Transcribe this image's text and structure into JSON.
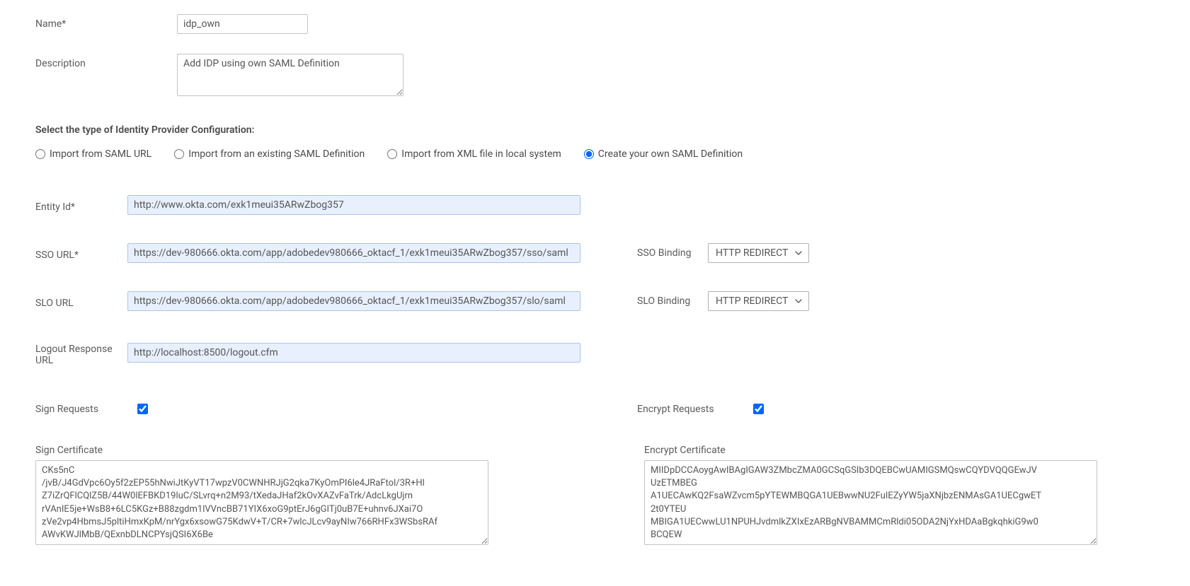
{
  "name": {
    "label": "Name*",
    "value": "idp_own"
  },
  "description": {
    "label": "Description",
    "value": "Add IDP using own SAML Definition"
  },
  "config_type": {
    "label": "Select the type of Identity Provider Configuration:",
    "options": {
      "import_url": "Import from SAML URL",
      "import_existing": "Import from an existing SAML Definition",
      "import_xml": "Import from XML file in local system",
      "create_own": "Create your own SAML Definition"
    },
    "selected": "create_own"
  },
  "entity_id": {
    "label": "Entity Id*",
    "value": "http://www.okta.com/exk1meui35ARwZbog357"
  },
  "sso_url": {
    "label": "SSO URL*",
    "value": "https://dev-980666.okta.com/app/adobedev980666_oktacf_1/exk1meui35ARwZbog357/sso/saml"
  },
  "sso_binding": {
    "label": "SSO Binding",
    "value": "HTTP REDIRECT"
  },
  "slo_url": {
    "label": "SLO URL",
    "value": "https://dev-980666.okta.com/app/adobedev980666_oktacf_1/exk1meui35ARwZbog357/slo/saml"
  },
  "slo_binding": {
    "label": "SLO Binding",
    "value": "HTTP REDIRECT"
  },
  "logout_response_url": {
    "label": "Logout Response URL",
    "value": "http://localhost:8500/logout.cfm"
  },
  "sign_requests": {
    "label": "Sign Requests",
    "checked": true
  },
  "encrypt_requests": {
    "label": "Encrypt Requests",
    "checked": true
  },
  "sign_certificate": {
    "label": "Sign Certificate",
    "value": "CKs5nC\n/jvB/J4GdVpc6Oy5f2zEP55hNwiJtKyVT17wpzV0CWNHRJjG2qka7KyOmPI6le4JRaFtol/3R+Hl\nZ7iZrQFlCQlZ5B/44W0lEFBKD19luC/SLvrq+n2M93/tXedaJHaf2kOvXAZvFaTrk/AdcLkgUjrn\nrVAnIE5je+WsB8+6LC5KGz+B88zgdm1lVVncBB71YIX6xoG9ptErJ6gGITj0uB7E+uhnv6JXai7O\nzVe2vp4HbmsJ5pltiHmxKpM/nrYgx6xsowG75KdwV+T/CR+7wlcJLcv9ayNIw766RHFx3WSbsRAf\nAWvKWJlMbB/QExnbDLNCPYsjQSI6X6Be"
  },
  "encrypt_certificate": {
    "label": "Encrypt Certificate",
    "value": "MIIDpDCCAoygAwIBAgIGAW3ZMbcZMA0GCSqGSIb3DQEBCwUAMIGSMQswCQYDVQQGEwJV\nUzETMBEG\nA1UECAwKQ2FsaWZvcm5pYTEWMBQGA1UEBwwNU2FuIEZyYW5jaXNjbzENMAsGA1UECgwET\n2t0YTEU\nMBIGA1UECwwLU1NPUHJvdmlkZXIxEzARBgNVBAMMCmRldi05ODA2NjYxHDAaBgkqhkiG9w0\nBCQEW"
  }
}
